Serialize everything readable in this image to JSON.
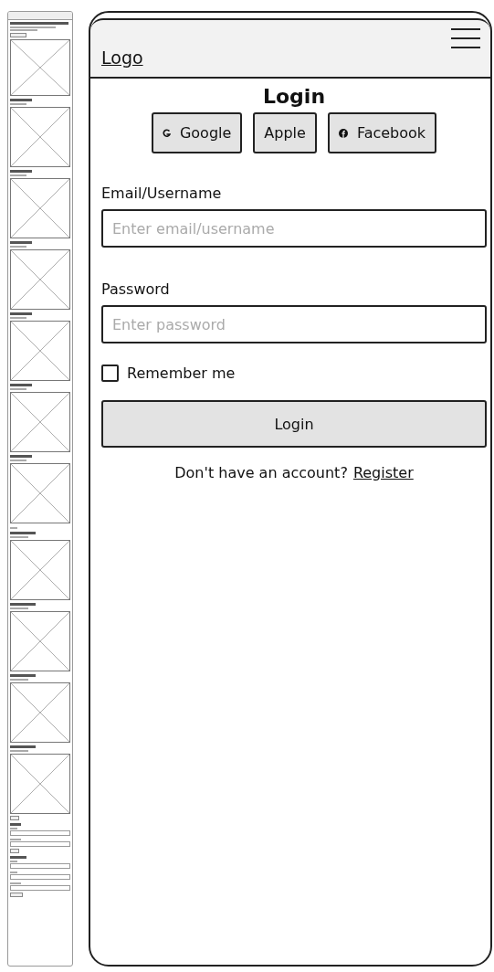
{
  "header": {
    "logo": "Logo"
  },
  "login": {
    "title": "Login",
    "social_buttons": [
      {
        "label": "Google",
        "kind": "google"
      },
      {
        "label": "Apple",
        "kind": "plain"
      },
      {
        "label": "Facebook",
        "kind": "facebook"
      }
    ],
    "fields": [
      {
        "label": "Email/Username",
        "placeholder": "Enter email/username"
      },
      {
        "label": "Password",
        "placeholder": "Enter password"
      }
    ],
    "remember": {
      "label": "Remember me",
      "checked": false
    },
    "submit": "Login",
    "footer": {
      "text": "Don't have an account?",
      "link": "Register"
    }
  }
}
